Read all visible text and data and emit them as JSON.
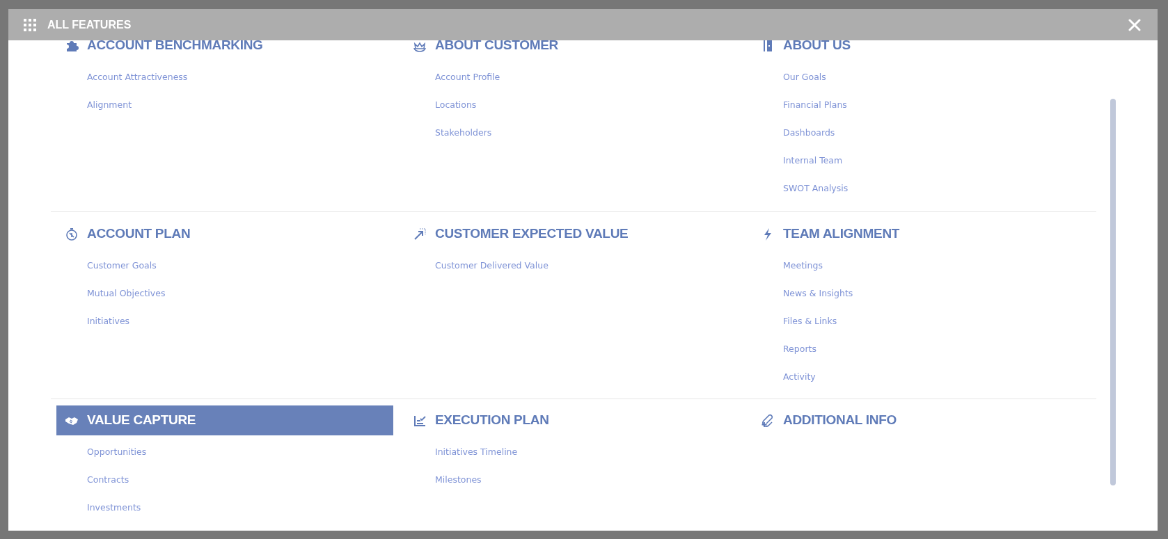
{
  "window": {
    "title": "ALL FEATURES"
  },
  "rows": [
    {
      "sections": [
        {
          "title": "ACCOUNT BENCHMARKING",
          "selected": false,
          "links": [
            "Account Attractiveness",
            "Alignment"
          ]
        },
        {
          "title": "ABOUT CUSTOMER",
          "selected": false,
          "links": [
            "Account Profile",
            "Locations",
            "Stakeholders"
          ]
        },
        {
          "title": "ABOUT US",
          "selected": false,
          "links": [
            "Our Goals",
            "Financial Plans",
            "Dashboards",
            "Internal Team",
            "SWOT Analysis"
          ]
        }
      ]
    },
    {
      "sections": [
        {
          "title": "ACCOUNT PLAN",
          "selected": false,
          "links": [
            "Customer Goals",
            "Mutual Objectives",
            "Initiatives"
          ]
        },
        {
          "title": "CUSTOMER EXPECTED VALUE",
          "selected": false,
          "links": [
            "Customer Delivered Value"
          ]
        },
        {
          "title": "TEAM ALIGNMENT",
          "selected": false,
          "links": [
            "Meetings",
            "News & Insights",
            "Files & Links",
            "Reports",
            "Activity"
          ]
        }
      ]
    },
    {
      "sections": [
        {
          "title": "VALUE CAPTURE",
          "selected": true,
          "links": [
            "Opportunities",
            "Contracts",
            "Investments"
          ]
        },
        {
          "title": "EXECUTION PLAN",
          "selected": false,
          "links": [
            "Initiatives Timeline",
            "Milestones"
          ]
        },
        {
          "title": "ADDITIONAL INFO",
          "selected": false
        }
      ]
    }
  ]
}
